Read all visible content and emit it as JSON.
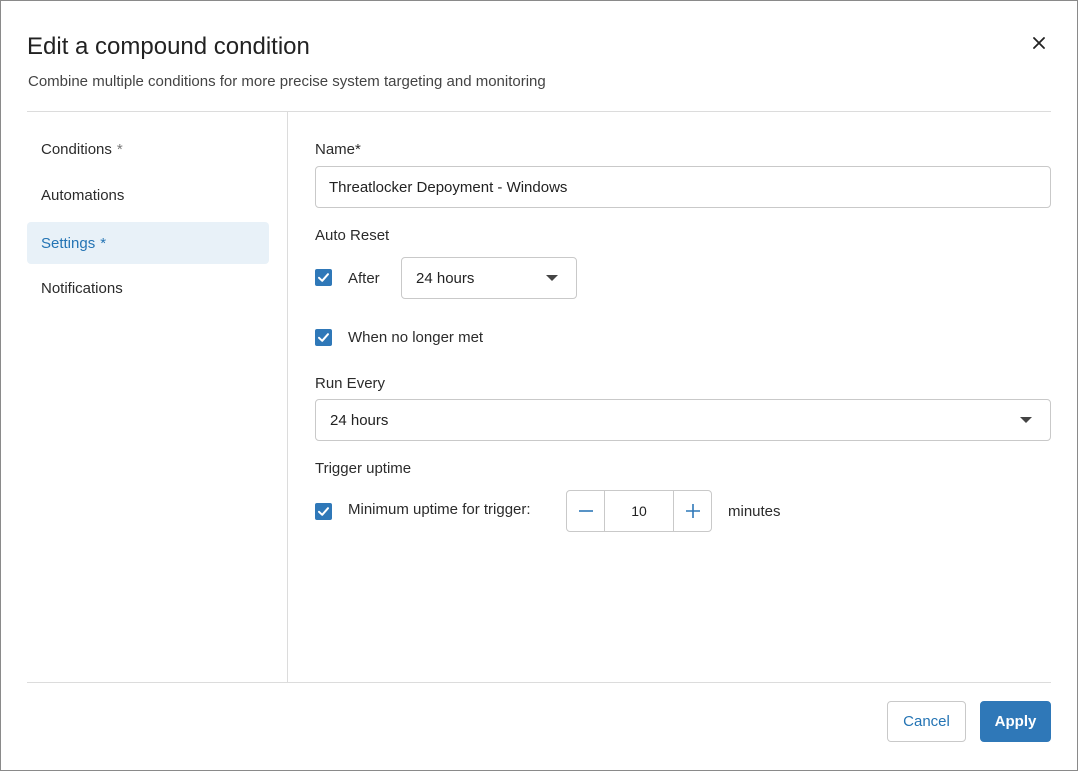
{
  "dialog": {
    "title": "Edit a compound condition",
    "subtitle": "Combine multiple conditions for more precise system targeting and monitoring",
    "close_icon": "close-icon"
  },
  "nav": {
    "items": [
      {
        "label": "Conditions",
        "required": "*",
        "active": false
      },
      {
        "label": "Automations",
        "required": "",
        "active": false
      },
      {
        "label": "Settings",
        "required": "*",
        "active": true
      },
      {
        "label": "Notifications",
        "required": "",
        "active": false
      }
    ]
  },
  "settings": {
    "name_label": "Name*",
    "name_value": "Threatlocker Depoyment - Windows",
    "auto_reset_label": "Auto Reset",
    "after_label": "After",
    "after_checked": true,
    "after_value": "24 hours",
    "no_longer_met_label": "When no longer met",
    "no_longer_met_checked": true,
    "run_every_label": "Run Every",
    "run_every_value": "24 hours",
    "trigger_uptime_label": "Trigger uptime",
    "min_uptime_label": "Minimum uptime for trigger:",
    "min_uptime_checked": true,
    "min_uptime_value": "10",
    "min_uptime_unit": "minutes"
  },
  "footer": {
    "cancel_label": "Cancel",
    "apply_label": "Apply"
  },
  "colors": {
    "accent": "#2f78b8",
    "active_nav_bg": "#e8f1f8",
    "link": "#2474b4"
  }
}
